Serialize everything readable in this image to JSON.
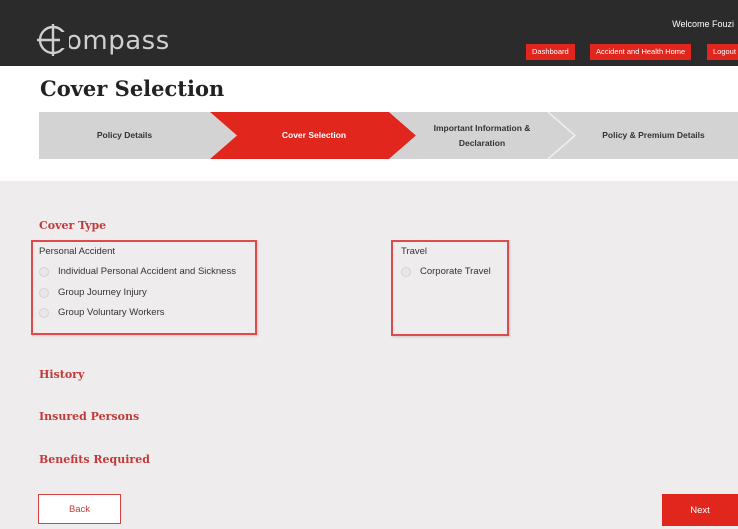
{
  "app": {
    "logo_text": "ompass",
    "welcome": "Welcome Fouzi",
    "buttons": {
      "dashboard": "Dashboard",
      "accident_health_home": "Accident and Health Home",
      "logout": "Logout"
    }
  },
  "page": {
    "title": "Cover Selection"
  },
  "steps": [
    {
      "label": "Policy Details",
      "active": false
    },
    {
      "label": "Cover Selection",
      "active": true
    },
    {
      "label": "Important Information & Declaration",
      "active": false
    },
    {
      "label": "Policy & Premium Details",
      "active": false
    }
  ],
  "cover_type": {
    "title": "Cover Type",
    "personal_accident": {
      "label": "Personal Accident",
      "options": [
        "Individual Personal Accident and Sickness",
        "Group Journey Injury",
        "Group Voluntary Workers"
      ]
    },
    "travel": {
      "label": "Travel",
      "options": [
        "Corporate Travel"
      ]
    }
  },
  "sections": {
    "history": "History",
    "insured_persons": "Insured Persons",
    "benefits_required": "Benefits Required"
  },
  "actions": {
    "back": "Back",
    "next": "Next"
  },
  "colors": {
    "header_bg": "#2b2b2b",
    "accent_red": "#e0261d",
    "section_title": "#c13a3a",
    "step_inactive": "#d3d3d3",
    "panel_bg": "#eeeced"
  }
}
